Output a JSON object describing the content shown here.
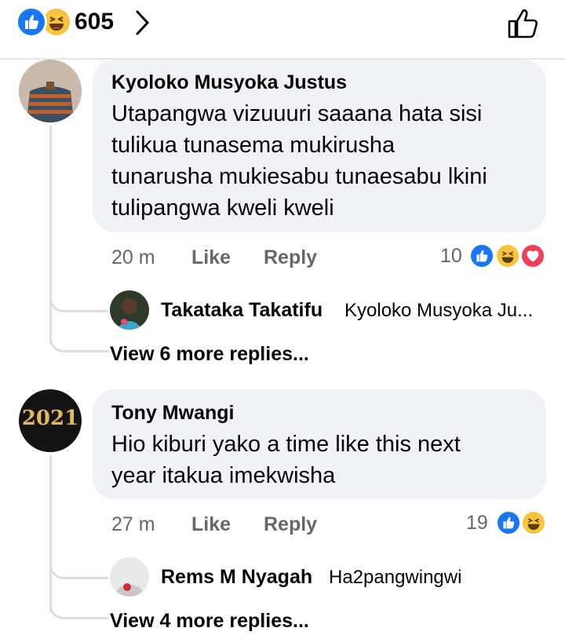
{
  "header": {
    "reaction_icons": [
      "like-icon",
      "haha-icon"
    ],
    "reaction_count": "605",
    "chevron_icon": "chevron-right-icon",
    "like_button_icon": "thumbs-up-outline-icon"
  },
  "comments": [
    {
      "author": "Kyoloko Musyoka Justus",
      "text_lines": [
        "Utapangwa vizuuuri saaana hata sisi",
        "tulikua tunasema mukirusha",
        "tunarusha mukiesabu tunaesabu lkini",
        "tulipangwa kweli kweli"
      ],
      "time": "20 m",
      "like_label": "Like",
      "reply_label": "Reply",
      "reaction_count": "10",
      "reaction_icons": [
        "like-icon",
        "haha-icon",
        "love-icon"
      ],
      "reply": {
        "author": "Takataka Takatifu",
        "text": "Kyoloko Musyoka Ju..."
      },
      "more_replies": "View 6 more replies..."
    },
    {
      "author": "Tony Mwangi",
      "avatar_text": "2021",
      "text_lines": [
        "Hio kiburi yako a time like this next",
        "year itakua imekwisha"
      ],
      "time": "27 m",
      "like_label": "Like",
      "reply_label": "Reply",
      "reaction_count": "19",
      "reaction_icons": [
        "like-icon",
        "haha-icon"
      ],
      "reply": {
        "author": "Rems M Nyagah",
        "text": "Ha2pangwingwi"
      },
      "more_replies": "View 4 more replies..."
    }
  ],
  "colors": {
    "like": "#1877f2",
    "haha": "#f7c53b",
    "love": "#f33e58",
    "bubble": "#f0f2f5",
    "meta": "#65676b"
  }
}
